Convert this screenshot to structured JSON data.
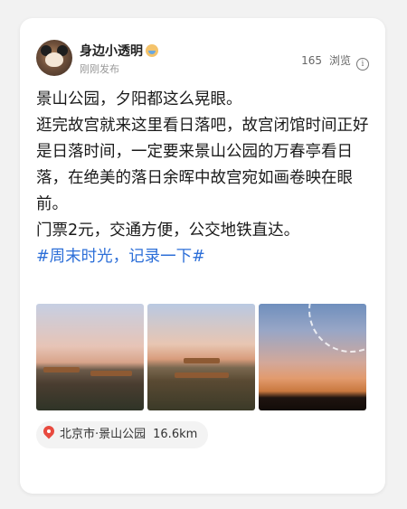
{
  "post": {
    "author": {
      "name": "身边小透明",
      "time": "刚刚发布"
    },
    "views": {
      "count": "165",
      "label": "浏览"
    },
    "content": {
      "lines": [
        "景山公园，夕阳都这么晃眼。",
        "逛完故宫就来这里看日落吧，故宫闭馆时间正好是日落时间，一定要来景山公园的万春亭看日落，在绝美的落日余晖中故宫宛如画卷映在眼前。",
        "门票2元，交通方便，公交地铁直达。"
      ],
      "hashtag": "#周末时光，记录一下#"
    },
    "photos": [
      "photo-1",
      "photo-2",
      "photo-3"
    ],
    "location": {
      "name": "北京市·景山公园",
      "distance": "16.6km"
    },
    "colors": {
      "hashtag": "#2d6fd8",
      "pin": "#e84a3f"
    },
    "icons": {
      "verified": "user-badge-icon",
      "info": "info-icon",
      "location": "location-pin-icon"
    }
  }
}
